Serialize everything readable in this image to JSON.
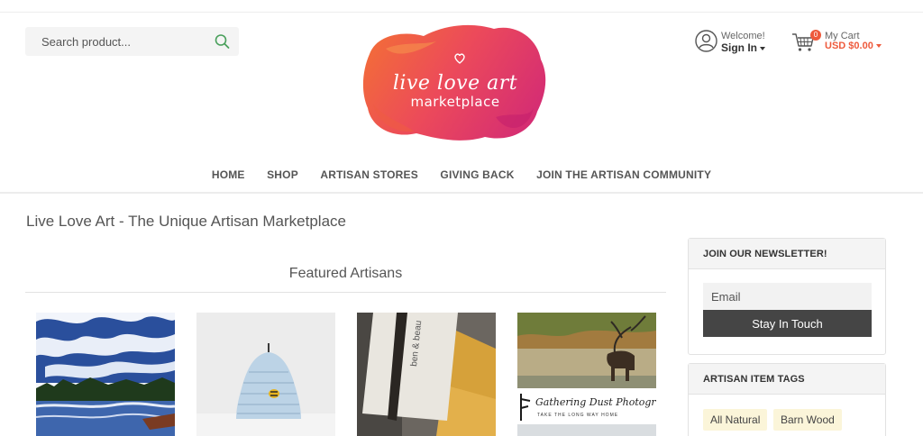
{
  "header": {
    "search_placeholder": "Search product...",
    "logo": {
      "line1": "live love art",
      "line2": "marketplace"
    },
    "account": {
      "welcome": "Welcome!",
      "signin": "Sign In"
    },
    "cart": {
      "label": "My Cart",
      "total": "USD $0.00",
      "count": "0"
    }
  },
  "nav": {
    "items": [
      "HOME",
      "SHOP",
      "ARTISAN STORES",
      "GIVING BACK",
      "JOIN THE ARTISAN COMMUNITY"
    ]
  },
  "main": {
    "page_title": "Live Love Art - The Unique Artisan Marketplace",
    "featured_title": "Featured Artisans",
    "thumb_texts": {
      "soap_brand": "ben & beau",
      "photo_brand": "Gathering Dust Photograph",
      "photo_tagline": "TAKE THE LONG WAY HOME"
    }
  },
  "sidebar": {
    "newsletter": {
      "title": "JOIN OUR NEWSLETTER!",
      "email_placeholder": "Email",
      "button": "Stay In Touch"
    },
    "tags": {
      "title": "ARTISAN ITEM TAGS",
      "items": [
        "All Natural",
        "Barn Wood"
      ]
    }
  },
  "colors": {
    "accent": "#ee5a3c",
    "button": "#454545",
    "tag_bg": "#fbf5d9",
    "logo_pink": "#e0356e",
    "logo_orange": "#f26a3b"
  },
  "icons": [
    "search-icon",
    "user-icon",
    "cart-icon",
    "heart-icon",
    "caret-down-icon"
  ]
}
